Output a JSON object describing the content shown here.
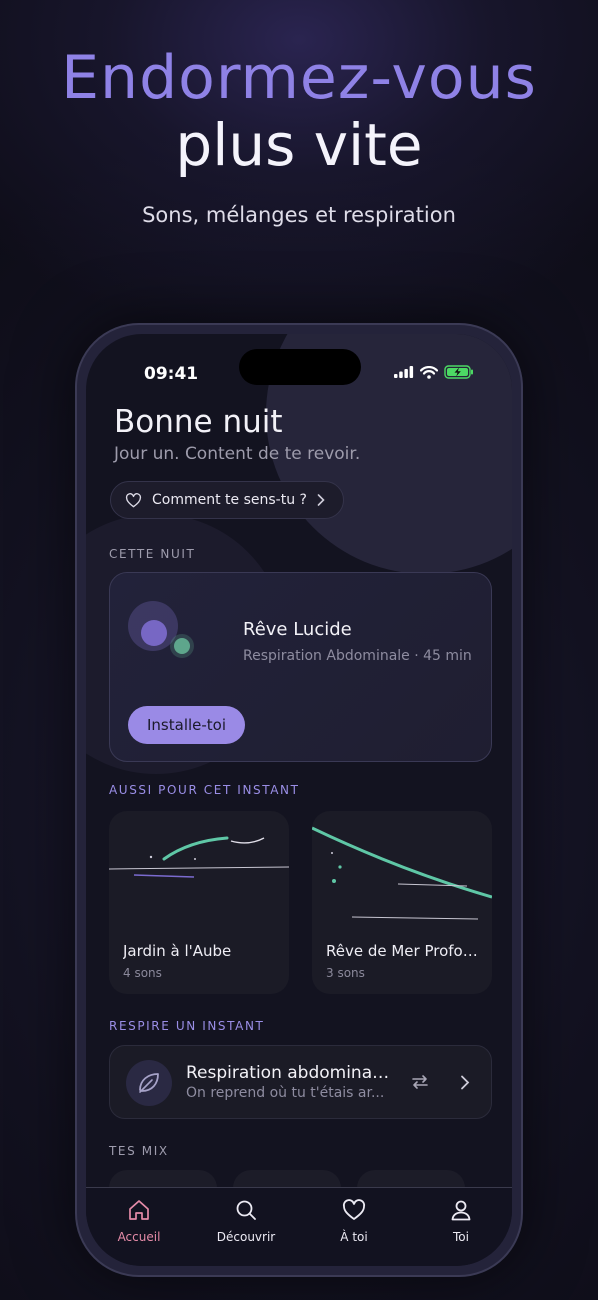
{
  "hero": {
    "title_line1": "Endormez-vous",
    "title_line2": "plus vite",
    "subtitle": "Sons, mélanges et respiration"
  },
  "status_bar": {
    "time": "09:41"
  },
  "header": {
    "greeting": "Bonne nuit",
    "subtitle": "Jour un. Content de te revoir.",
    "mood_button": "Comment te sens-tu ?"
  },
  "tonight": {
    "section_label": "CETTE NUIT",
    "title": "Rêve Lucide",
    "meta": "Respiration Abdominale · 45 min",
    "cta": "Installe-toi"
  },
  "also": {
    "section_label": "AUSSI POUR CET INSTANT",
    "items": [
      {
        "title": "Jardin à l'Aube",
        "count": "4 sons"
      },
      {
        "title": "Rêve de Mer Profon...",
        "count": "3 sons"
      }
    ]
  },
  "breathe": {
    "section_label": "RESPIRE UN INSTANT",
    "title": "Respiration abdominal...",
    "subtitle": "On reprend où tu t'étais ar..."
  },
  "mixes": {
    "section_label": "TES MIX"
  },
  "tabs": [
    {
      "label": "Accueil",
      "icon": "home-icon",
      "active": true
    },
    {
      "label": "Découvrir",
      "icon": "search-icon",
      "active": false
    },
    {
      "label": "À toi",
      "icon": "heart-icon",
      "active": false
    },
    {
      "label": "Toi",
      "icon": "person-icon",
      "active": false
    }
  ],
  "colors": {
    "accent_violet": "#9a8ae6",
    "accent_teal": "#5fc7a6",
    "active_tab_pink": "#e58ba8",
    "battery_green": "#4cd964"
  }
}
